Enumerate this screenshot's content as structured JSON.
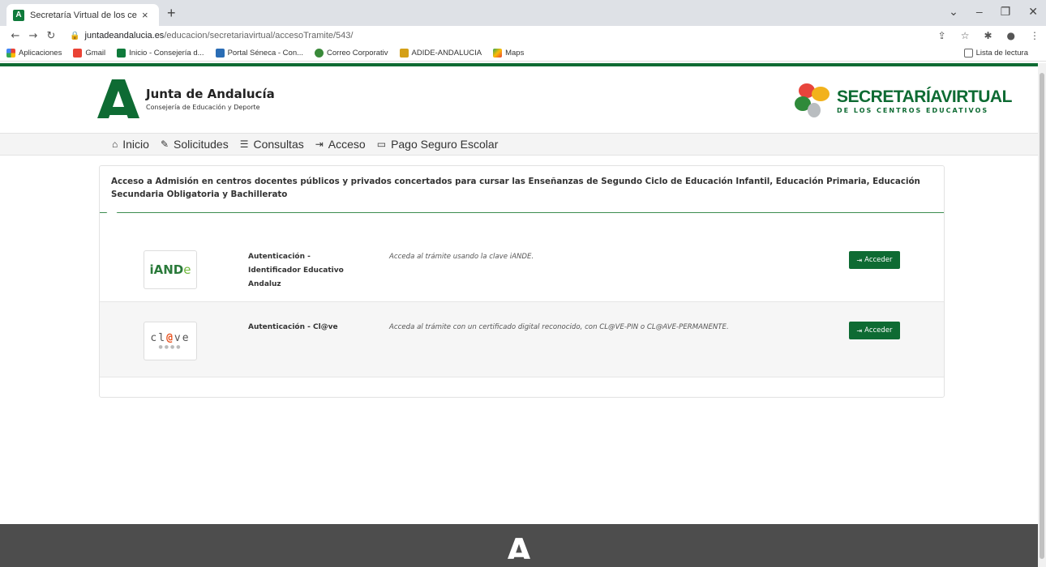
{
  "browser": {
    "tab_title": "Secretaría Virtual de los centros",
    "tab_close": "×",
    "new_tab": "+",
    "url_host": "juntadeandalucia.es",
    "url_path": "/educacion/secretariavirtual/accesoTramite/543/",
    "bookmarks": [
      "Aplicaciones",
      "Gmail",
      "Inicio - Consejería d...",
      "Portal Séneca - Con...",
      "Correo Corporativ",
      "ADIDE-ANDALUCIA",
      "Maps"
    ],
    "reading_list": "Lista de lectura"
  },
  "header": {
    "org_title": "Junta de Andalucía",
    "org_subtitle": "Consejería de Educación y Deporte",
    "sv_title_a": "SECRETARÍA",
    "sv_title_b": "VIRTUAL",
    "sv_subtitle": "DE LOS CENTROS EDUCATIVOS"
  },
  "nav": {
    "inicio": "Inicio",
    "solicitudes": "Solicitudes",
    "consultas": "Consultas",
    "acceso": "Acceso",
    "pago": "Pago Seguro Escolar"
  },
  "panel": {
    "title": "Acceso a Admisión en centros docentes públicos y privados concertados para cursar las Enseñanzas de Segundo Ciclo de Educación Infantil, Educación Primaria, Educación Secundaria Obligatoria y Bachillerato",
    "methods": [
      {
        "logo_a": "iAND",
        "logo_b": "e",
        "name": "Autenticación - Identificador Educativo Andaluz",
        "description": "Acceda al trámite usando la clave iANDE.",
        "button": "Acceder"
      },
      {
        "logo_a": "cl",
        "logo_at": "@",
        "logo_b": "ve",
        "logo_dots": "●●●●",
        "name": "Autenticación - Cl@ve",
        "description": "Acceda al trámite con un certificado digital reconocido, con CL@VE-PIN o CL@AVE-PERMANENTE.",
        "button": "Acceder"
      }
    ]
  },
  "colors": {
    "brand_green": "#0e6b33",
    "footer": "#4d4d4d"
  }
}
